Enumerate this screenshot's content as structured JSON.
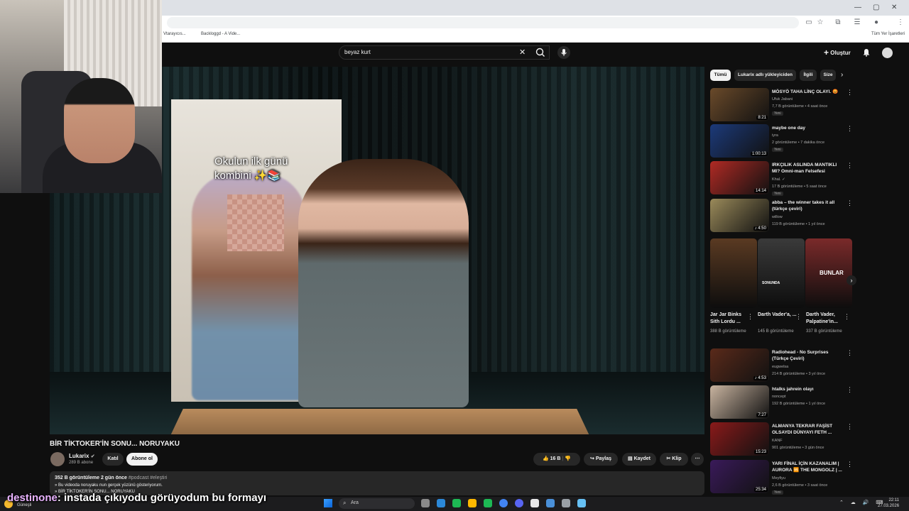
{
  "browser": {
    "bookmarks": [
      "Vtarayıcıs...",
      "Backloggd - A Vide..."
    ],
    "all_bookmarks": "Tüm Yer İşaretleri"
  },
  "header": {
    "search_value": "beyaz kurt",
    "create_label": "Oluştur"
  },
  "video": {
    "overlay_text": "Okulun ilk günü kombini ✨📚",
    "title": "BİR TİKTOKER'İN SONU... NORUYAKU",
    "channel": "Lukarix",
    "subscribers": "289 B abone",
    "join_label": "Katıl",
    "subscribe_label": "Abone ol",
    "likes": "16 B",
    "share_label": "Paylaş",
    "save_label": "Kaydet",
    "clip_label": "Klip",
    "views": "352 B görüntüleme",
    "age": "2 gün önce",
    "tags": "#podcast #eleştiri",
    "desc_line1": "» Bu videoda noruyaku nun gerçek yüzünü gösteriyorum.",
    "desc_line2": "» BİR TİKTOKER'İN SONU... NORUYAKU"
  },
  "chips": [
    "Tümü",
    "Lukarix adlı yükleyiciden",
    "İlgili",
    "Size"
  ],
  "recommendations_top": [
    {
      "title": "MÖSYÖ TAHA LİNÇ OLAYI. 😡",
      "channel": "Ufuk Jabani",
      "meta": "7,7 B görüntüleme • 4 saat önce",
      "badge": "Yeni",
      "duration": "8:21",
      "color": "#6a4a2a"
    },
    {
      "title": "maybe one day",
      "channel": "iyra",
      "meta": "2 görüntüleme • 7 dakika önce",
      "badge": "Yeni",
      "duration": "1:00:13",
      "color": "#1c3a7a"
    },
    {
      "title": "IRKÇILIK ASLINDA MANTIKLI MI? Omni-man Felsefesi",
      "channel": "Khal. ✓",
      "meta": "17 B görüntüleme • 5 saat önce",
      "badge": "Yeni",
      "duration": "14:14",
      "color": "#b02a24"
    },
    {
      "title": "abba – the winner takes it all (türkçe çeviri)",
      "channel": "willow",
      "meta": "119 B görüntüleme • 1 yıl önce",
      "badge": "",
      "duration": "♪ 4:50",
      "color": "#9a8a5a"
    }
  ],
  "shorts": [
    {
      "title": "Jar Jar Binks Sith Lordu ...",
      "meta": "388 B görüntüleme",
      "color": "#5a3a22"
    },
    {
      "title": "Darth Vader'a, ...",
      "meta": "145 B görüntüleme",
      "color": "#3a3a3a"
    },
    {
      "title": "Darth Vader, Palpatine'in...",
      "meta": "337 B görüntüleme",
      "color": "#7a2a2a"
    }
  ],
  "shorts_overlay_2": "SONUNDA",
  "shorts_overlay_3": "BUNLAR",
  "recommendations_bottom": [
    {
      "title": "Radiohead - No Surprises (Türkçe Çeviri)",
      "channel": "eugwelsa",
      "meta": "214 B görüntüleme • 3 yıl önce",
      "badge": "",
      "duration": "♪ 4:53",
      "color": "#5a2a1a"
    },
    {
      "title": "htalks jahrein olayı",
      "channel": "noncept",
      "meta": "192 B görüntüleme • 1 yıl önce",
      "badge": "",
      "duration": "7:27",
      "color": "#c9b4a0"
    },
    {
      "title": "ALMANYA TEKRAR FAŞİST OLSAYDI DÜNYAYI FETH ...",
      "channel": "KANF",
      "meta": "901 görüntüleme • 3 gün önce",
      "badge": "",
      "duration": "15:23",
      "color": "#8a1a1a"
    },
    {
      "title": "YARI FİNAL İÇİN KAZANALIM | AURORA 🆚 THE MONGOLZ | ...",
      "channel": "Meyfiyu",
      "meta": "2,6 B görüntüleme • 3 saat önce",
      "badge": "Yeni",
      "duration": "25:34",
      "color": "#3a1a5a"
    }
  ],
  "chat": {
    "user": "destinone",
    "message": ": instada çıkıyodu görüyodum bu formayı"
  },
  "taskbar": {
    "weather": "Güneşli",
    "search_placeholder": "Ara",
    "time": "22:11",
    "date": "27.03.2026"
  }
}
